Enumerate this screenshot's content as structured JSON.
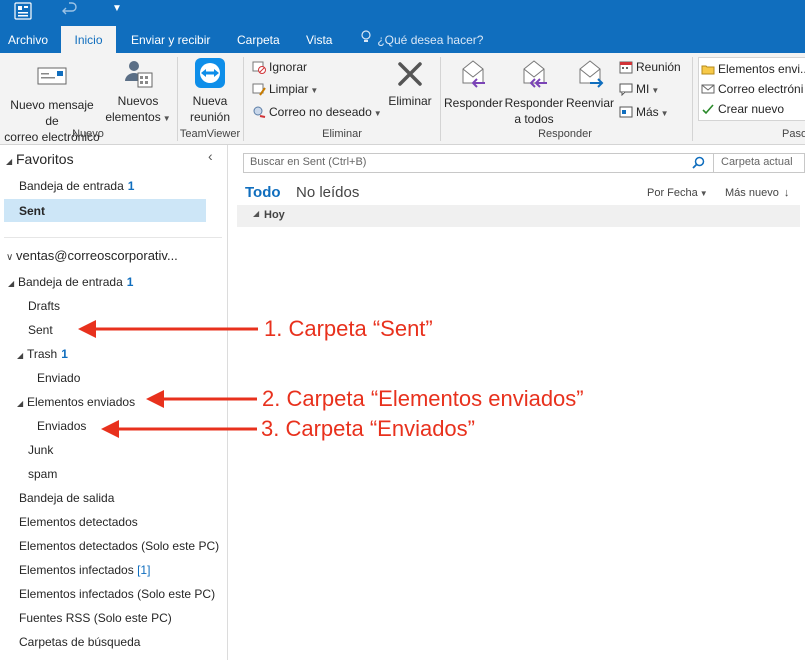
{
  "titlebar": {
    "icons": [
      "outlook-app-icon",
      "undo-icon",
      "customize-quick-access-icon"
    ]
  },
  "tabs": [
    {
      "label": "Archivo"
    },
    {
      "label": "Inicio"
    },
    {
      "label": "Enviar y recibir"
    },
    {
      "label": "Carpeta"
    },
    {
      "label": "Vista"
    }
  ],
  "tellme": "¿Qué desea hacer?",
  "ribbon": {
    "nuevo": {
      "new_email_line1": "Nuevo mensaje de",
      "new_email_line2": "correo electrónico",
      "new_items_line1": "Nuevos",
      "new_items_line2": "elementos",
      "group": "Nuevo"
    },
    "teamviewer": {
      "line1": "Nueva",
      "line2": "reunión",
      "group": "TeamViewer"
    },
    "eliminar": {
      "ignore": "Ignorar",
      "clean": "Limpiar",
      "junk": "Correo no deseado",
      "delete": "Eliminar",
      "group": "Eliminar"
    },
    "responder": {
      "reply": "Responder",
      "reply_all_line1": "Responder",
      "reply_all_line2": "a todos",
      "forward": "Reenviar",
      "meeting": "Reunión",
      "im": "MI",
      "more": "Más",
      "group": "Responder"
    },
    "quick": {
      "item1": "Elementos envi...",
      "item2": "Correo electróni",
      "item3": "Crear nuevo",
      "group": "Pasos"
    }
  },
  "nav": {
    "favorites": "Favoritos",
    "collapse_glyph": "‹",
    "fav_inbox": "Bandeja de entrada",
    "fav_inbox_count": "1",
    "fav_sent": "Sent",
    "account": "ventas@correoscorporativ...",
    "inbox": "Bandeja de entrada",
    "inbox_count": "1",
    "drafts": "Drafts",
    "sent": "Sent",
    "trash": "Trash",
    "trash_count": "1",
    "enviado": "Enviado",
    "elementos_enviados": "Elementos enviados",
    "enviados": "Enviados",
    "junk": "Junk",
    "spam": "spam",
    "outbox": "Bandeja de salida",
    "detected": "Elementos detectados",
    "detected_pc": "Elementos detectados (Solo este PC)",
    "infected": "Elementos infectados",
    "infected_count": "[1]",
    "infected_pc": "Elementos infectados (Solo este PC)",
    "rss": "Fuentes RSS (Solo este PC)",
    "search_folders": "Carpetas de búsqueda"
  },
  "list": {
    "search_placeholder": "Buscar en Sent (Ctrl+B)",
    "scope": "Carpeta actual",
    "filter_all": "Todo",
    "filter_unread": "No leídos",
    "sort_by": "Por Fecha",
    "sort_order": "Más nuevo",
    "group_today": "Hoy"
  },
  "annotations": {
    "a1": "1. Carpeta “Sent”",
    "a2": "2. Carpeta “Elementos enviados”",
    "a3": "3. Carpeta “Enviados”"
  },
  "colors": {
    "accent": "#106ebe",
    "annotation": "#e8311d",
    "selected": "#cde6f7"
  }
}
